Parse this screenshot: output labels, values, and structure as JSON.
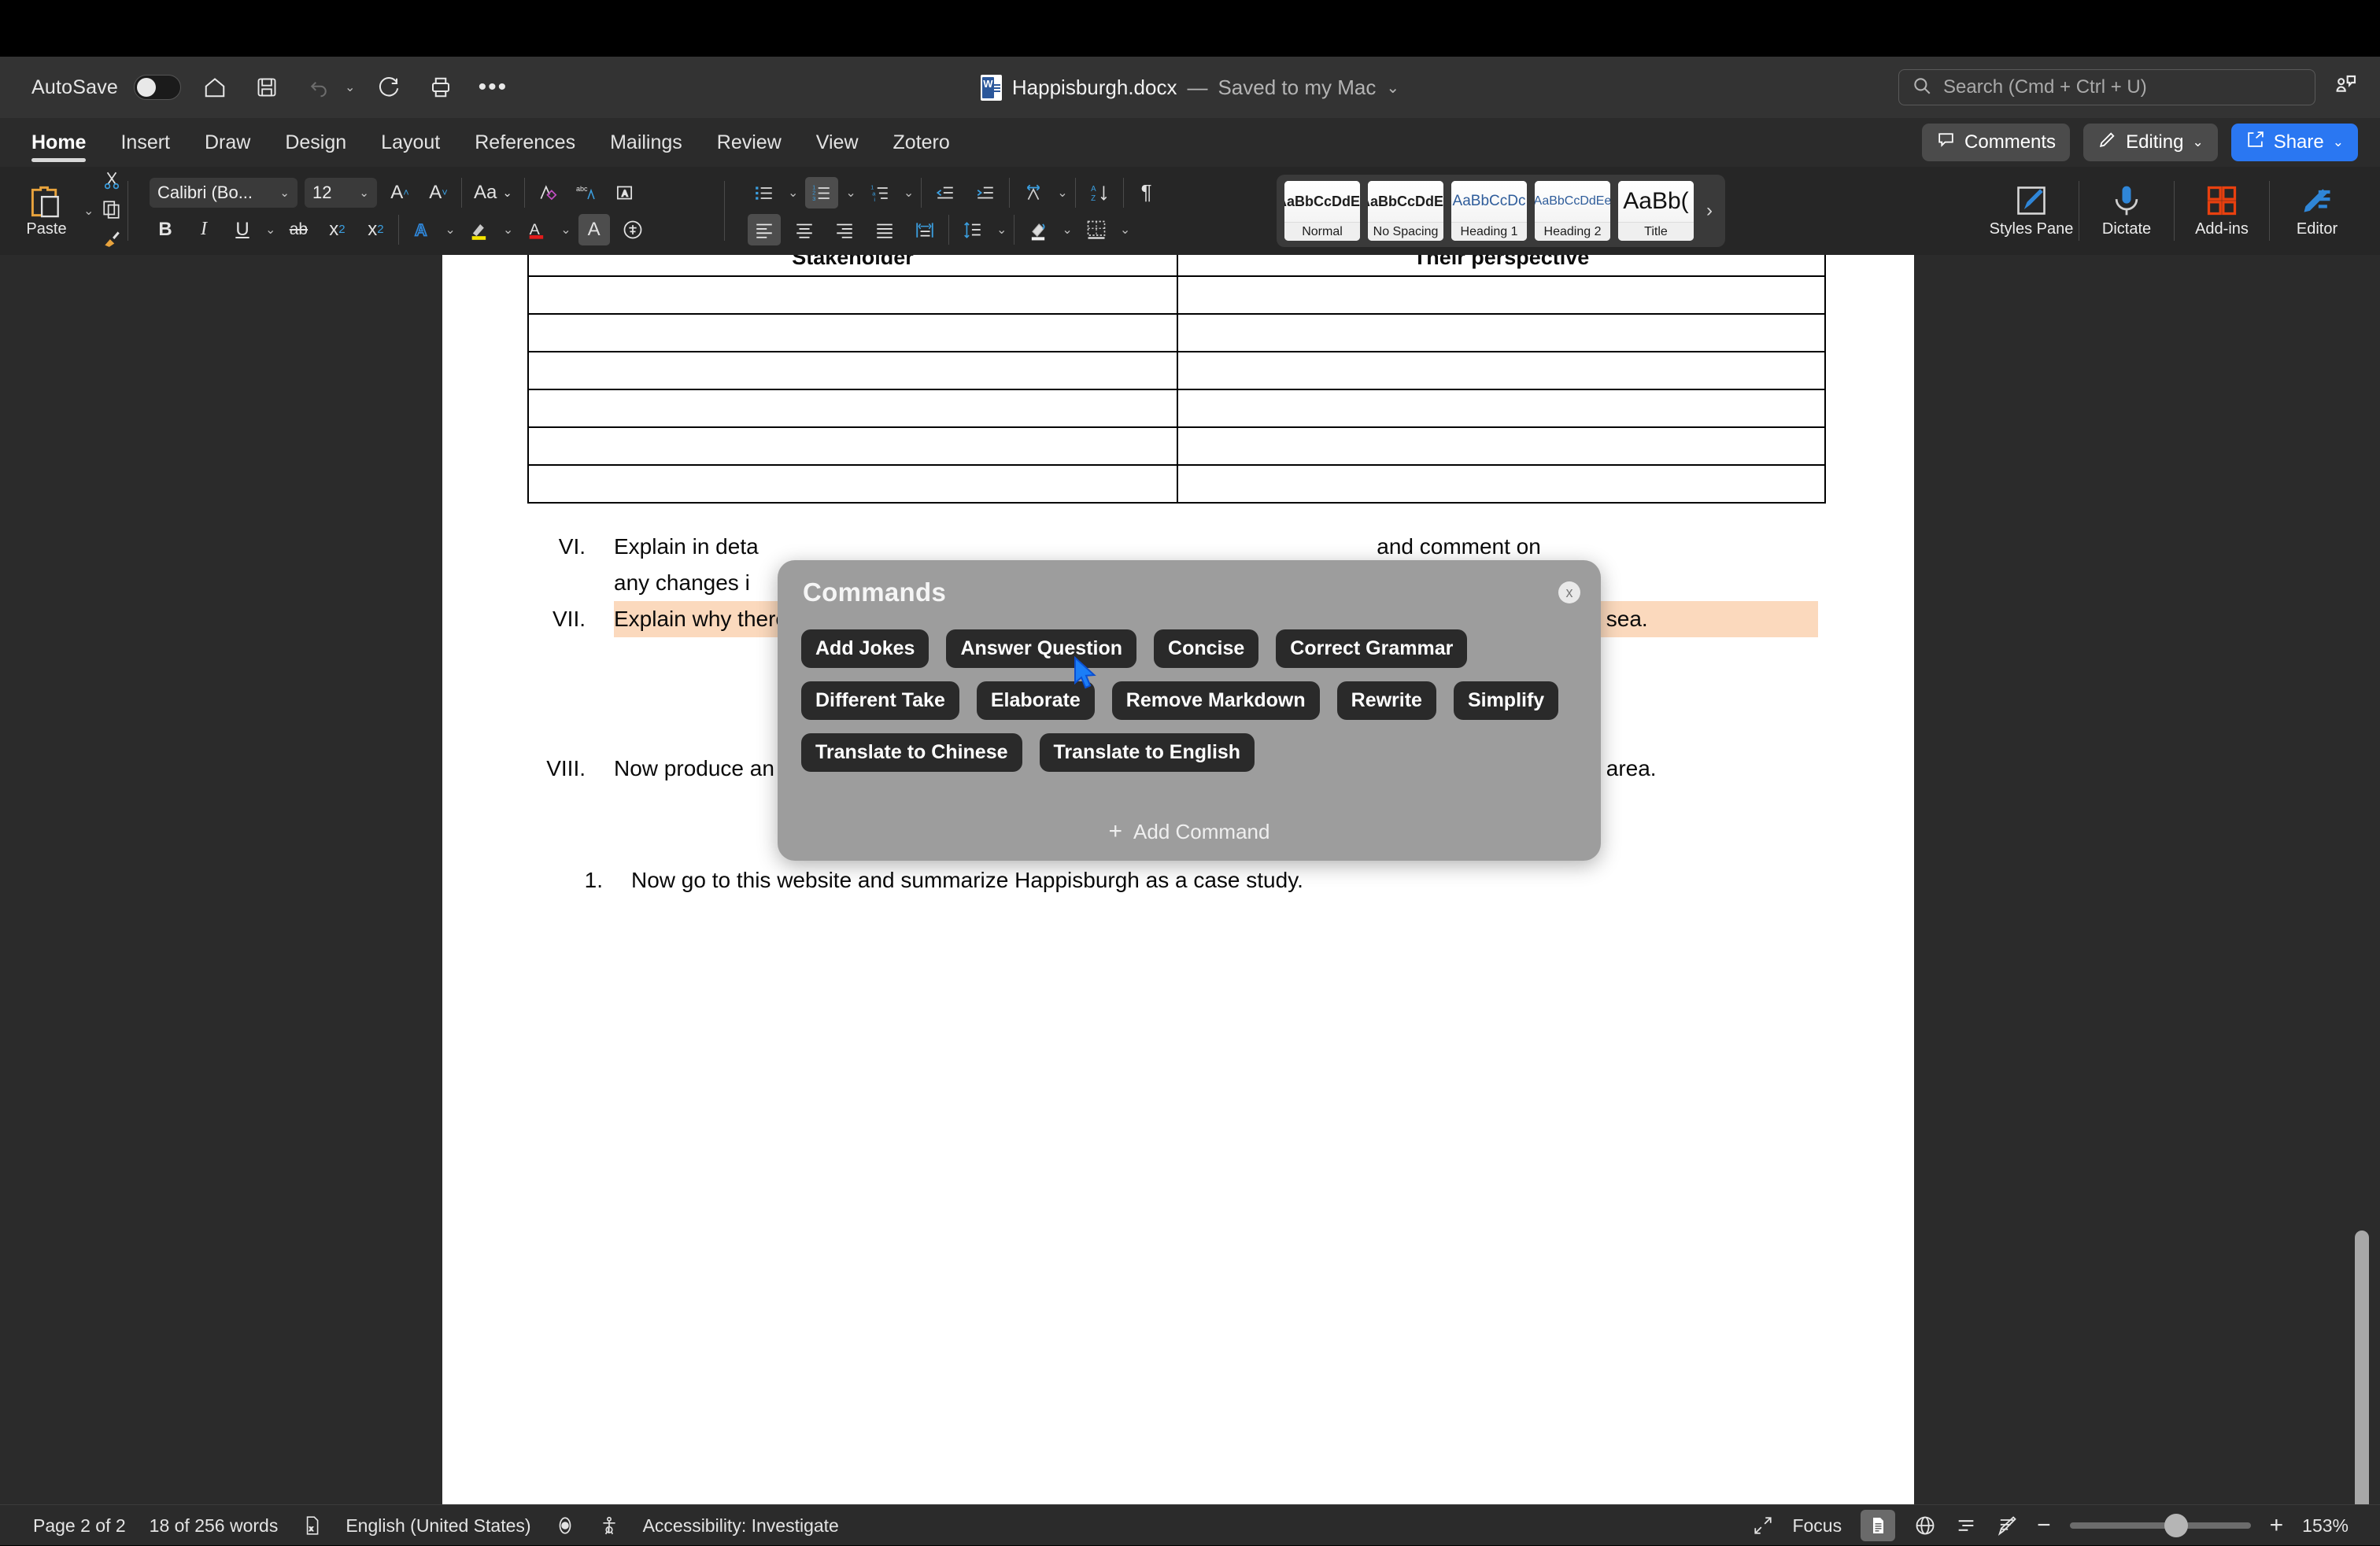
{
  "quick_access": {
    "autosave_label": "AutoSave",
    "autosave_state": "off",
    "icons": [
      "home-icon",
      "save-icon",
      "undo-icon",
      "redo-icon",
      "print-icon",
      "more-icon"
    ]
  },
  "title": {
    "file_name": "Happisburgh.docx",
    "separator": "—",
    "save_state": "Saved to my Mac",
    "chevron": "⌄"
  },
  "search": {
    "placeholder": "Search (Cmd + Ctrl + U)",
    "icon": "search-icon"
  },
  "account_icon": "user-presence-icon",
  "ribbon_tabs": [
    {
      "label": "Home",
      "active": true
    },
    {
      "label": "Insert",
      "active": false
    },
    {
      "label": "Draw",
      "active": false
    },
    {
      "label": "Design",
      "active": false
    },
    {
      "label": "Layout",
      "active": false
    },
    {
      "label": "References",
      "active": false
    },
    {
      "label": "Mailings",
      "active": false
    },
    {
      "label": "Review",
      "active": false
    },
    {
      "label": "View",
      "active": false
    },
    {
      "label": "Zotero",
      "active": false
    }
  ],
  "ribbon_actions": {
    "comments": "Comments",
    "editing": "Editing",
    "share": "Share",
    "share_color": "#2a77f2"
  },
  "ribbon": {
    "paste_label": "Paste",
    "font_name": "Calibri (Bo...",
    "font_size": "12",
    "bold": "B",
    "italic": "I",
    "underline": "U",
    "strikethrough": "ab",
    "subscript": "x₂",
    "superscript": "x²",
    "change_case": "Aa",
    "styles_pane_label": "Styles Pane",
    "dictate_label": "Dictate",
    "addins_label": "Add-ins",
    "editor_label": "Editor",
    "gallery_next": "›"
  },
  "style_gallery": [
    {
      "preview": "AaBbCcDdEe",
      "name": "Normal",
      "kind": "normal"
    },
    {
      "preview": "AaBbCcDdEe",
      "name": "No Spacing",
      "kind": "normal"
    },
    {
      "preview": "AaBbCcDc",
      "name": "Heading 1",
      "kind": "heading"
    },
    {
      "preview": "AaBbCcDdEe",
      "name": "Heading 2",
      "kind": "heading"
    },
    {
      "preview": "AaBb(",
      "name": "Title",
      "kind": "title"
    }
  ],
  "document": {
    "table": {
      "headers": [
        "Stakeholder",
        "Their perspective"
      ],
      "empty_rows": 6
    },
    "paragraphs": [
      {
        "number": "VI.",
        "text_before": "Explain in deta",
        "text_after": "and comment on",
        "line2_before": "any changes i",
        "highlighted": false
      },
      {
        "number": "VII.",
        "text": "Explain why there are disagreements on what should be done to stop Happisburgh crumbling into the sea.",
        "highlighted": true
      },
      {
        "number": "VIII.",
        "text": "Now produce an annotated map of Happisburgh and this coastline clearly showing the location of this area.",
        "highlighted": false
      },
      {
        "number": "1.",
        "text": "Now go to this website and summarize Happisburgh as a case study.",
        "highlighted": false
      }
    ],
    "highlight_color": "#fbd9bd"
  },
  "commands_panel": {
    "title": "Commands",
    "close_label": "x",
    "rows": [
      [
        "Add Jokes",
        "Answer Question",
        "Concise",
        "Correct Grammar"
      ],
      [
        "Different Take",
        "Elaborate",
        "Remove Markdown",
        "Rewrite",
        "Simplify"
      ],
      [
        "Translate to Chinese",
        "Translate to English"
      ]
    ],
    "add_command": "Add Command",
    "add_command_plus": "+"
  },
  "status_bar": {
    "page": "Page 2 of 2",
    "words": "18 of 256 words",
    "language": "English (United States)",
    "accessibility": "Accessibility: Investigate",
    "focus": "Focus",
    "zoom_minus": "−",
    "zoom_plus": "+",
    "zoom_level": "153%"
  }
}
